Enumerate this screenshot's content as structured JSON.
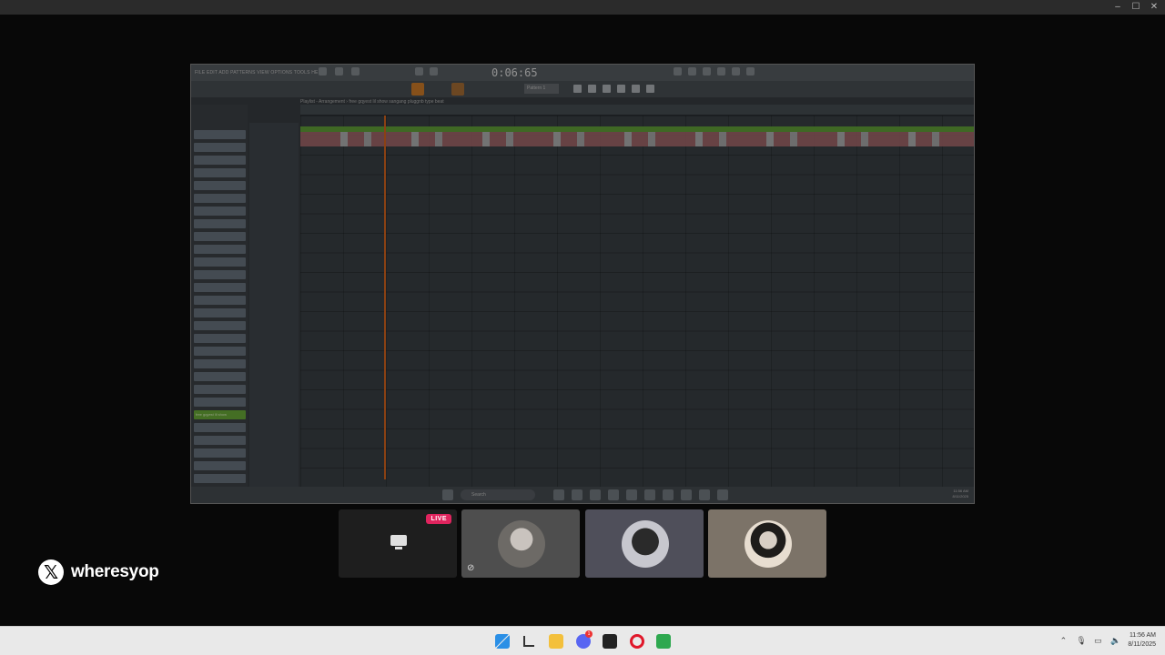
{
  "fl": {
    "menu": "FILE  EDIT  ADD  PATTERNS  VIEW  OPTIONS  TOOLS  HELP",
    "time": "0:06:65",
    "pattern": "Pattern 1",
    "playlist_title": "Playlist - Arrangement › free gqyest lil show sangang pluggnb type beat",
    "selected_clip": "free gqyest lil show",
    "search": "Search",
    "clock_time": "11:56 AM",
    "clock_date": "8/11/2025"
  },
  "live_label": "LIVE",
  "brand": {
    "handle": "wheresyop"
  },
  "taskbar": {
    "discord_badge": "1",
    "clock_time": "11:56 AM",
    "clock_date": "8/11/2025"
  }
}
